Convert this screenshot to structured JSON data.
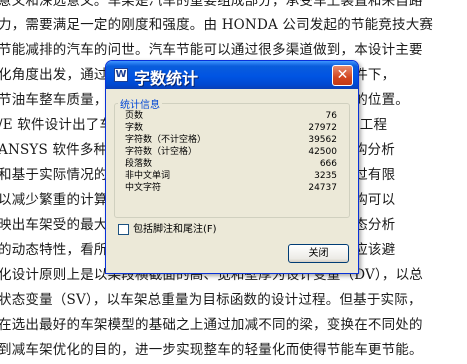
{
  "document": {
    "lines": [
      "意义和深远意义。车架是汽车的重要组成部分，承受车上装置和来自路",
      "力，需要满足一定的刚度和强度。由 HONDA 公司发起的节能竞技大赛",
      "节能减排的汽车的问世。汽车节能可以通过很多渠道做到，本设计主要",
      "化角度出发，通过对车架结构分析，在保证车架的强度的条件下，",
      "节油车整车质量，同时，车架的设计也影响着和决定了重心的位置。",
      "/E 软件设计出了车架，并通过有限元分析将车架模型转换成工程",
      "ANSYS 软件多种分析手段对车架进行了分析，包括静力结构分析",
      "和基于实际情况的多种工况分析，因为车架受力复杂性，通过有限",
      "以减少繁重的计算量，提高分析的准确性，还可通过静力结构可以",
      "映出车架受的最大应力与变形，进行强度刚度校核。通过模态分析",
      "的动态特性，看所设计的车架是否会与外界激励产生共振，应该避",
      "化设计原则上是以梁段横截面的高、宽和壁厚为设计变量（DV），以总",
      "状态变量（SV），以车架总重量为目标函数的设计过程。但基于实际，",
      "在选出最好的车架模型的基础之上通过加减不同的梁，变换在不同处的",
      "到减车架优化的目的，进一步实现整车的轻量化而使得节能车更节能。"
    ]
  },
  "dialog": {
    "title": "字数统计",
    "close_icon_glyph": "✕",
    "group_label": "统计信息",
    "stats": [
      {
        "label": "页数",
        "value": "76"
      },
      {
        "label": "字数",
        "value": "27972"
      },
      {
        "label": "字符数（不计空格）",
        "value": "39562"
      },
      {
        "label": "字符数（计空格）",
        "value": "42500"
      },
      {
        "label": "段落数",
        "value": "666"
      },
      {
        "label": "非中文单词",
        "value": "3235"
      },
      {
        "label": "中文字符",
        "value": "24737"
      }
    ],
    "checkbox_label": "包括脚注和尾注(F)",
    "checkbox_checked": false,
    "close_button_label": "关闭"
  }
}
